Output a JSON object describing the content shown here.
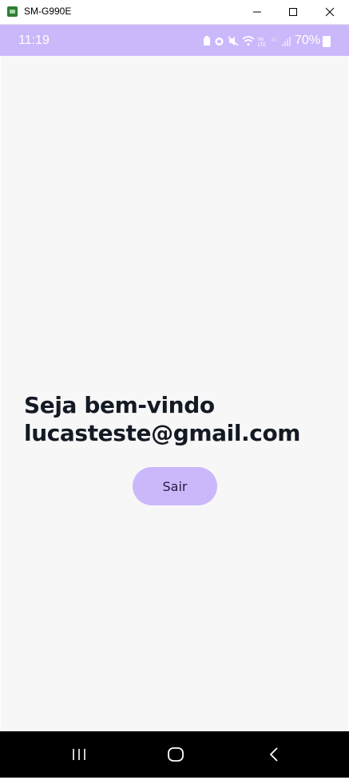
{
  "window": {
    "title": "SM-G990E"
  },
  "status_bar": {
    "time": "11:19",
    "battery": "70%",
    "icons": [
      "battery-saver-icon",
      "alarm-icon",
      "mute-icon",
      "wifi-icon",
      "volte-icon",
      "4g-icon",
      "signal-icon"
    ]
  },
  "main": {
    "welcome_line1": "Seja bem-vindo",
    "welcome_line2": "lucasteste@gmail.com",
    "logout_button": "Sair"
  },
  "colors": {
    "accent": "#cbb8fb",
    "background": "#f7f7f7",
    "text": "#141a24"
  }
}
